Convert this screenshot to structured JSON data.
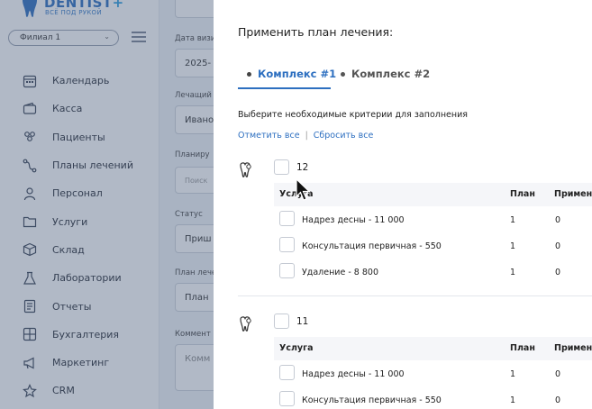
{
  "app": {
    "logo_name": "DENTIST",
    "logo_plus": "+",
    "logo_sub": "ВСЁ ПОД РУКОЙ",
    "branch_select": "Филиал 1",
    "menu": [
      {
        "label": "Календарь",
        "icon": "calendar-icon"
      },
      {
        "label": "Касса",
        "icon": "wallet-icon"
      },
      {
        "label": "Пациенты",
        "icon": "patients-icon"
      },
      {
        "label": "Планы лечений",
        "icon": "route-icon"
      },
      {
        "label": "Персонал",
        "icon": "staff-icon"
      },
      {
        "label": "Услуги",
        "icon": "folder-icon"
      },
      {
        "label": "Склад",
        "icon": "box-icon"
      },
      {
        "label": "Лаборатории",
        "icon": "flask-icon"
      },
      {
        "label": "Отчеты",
        "icon": "report-icon"
      },
      {
        "label": "Бухгалтерия",
        "icon": "calculator-icon"
      },
      {
        "label": "Маркетинг",
        "icon": "megaphone-icon"
      },
      {
        "label": "CRM",
        "icon": "crm-icon"
      }
    ]
  },
  "form": {
    "visit_date_label": "Дата визи",
    "visit_date_value": "2025-",
    "doctor_label": "Лечащий",
    "doctor_value": "Ивано",
    "planned_label": "Планиру",
    "search_placeholder": "Поиск",
    "status_label": "Статус",
    "status_value": "Приш",
    "plan_label": "План лече",
    "plan_value": "План",
    "comment_label": "Коммент",
    "comment_placeholder": "Комм"
  },
  "modal": {
    "title": "Применить план лечения:",
    "tabs": [
      "Комплекс #1",
      "Комплекс #2"
    ],
    "instruction": "Выберите необходимые критерии для заполнения",
    "select_all": "Отметить все",
    "separator": "|",
    "reset_all": "Сбросить все",
    "columns": {
      "service": "Услуга",
      "plan": "План",
      "applied": "Примен"
    },
    "groups": [
      {
        "tooth": "12",
        "rows": [
          {
            "name": "Надрез десны - 11 000",
            "plan": "1",
            "applied": "0"
          },
          {
            "name": "Консультация первичная - 550",
            "plan": "1",
            "applied": "0"
          },
          {
            "name": "Удаление - 8 800",
            "plan": "1",
            "applied": "0"
          }
        ]
      },
      {
        "tooth": "11",
        "rows": [
          {
            "name": "Надрез десны - 11 000",
            "plan": "1",
            "applied": "0"
          },
          {
            "name": "Консультация первичная - 550",
            "plan": "1",
            "applied": "0"
          }
        ]
      }
    ]
  },
  "colors": {
    "accent": "#2d6fc0",
    "overlay": "#46587a"
  }
}
